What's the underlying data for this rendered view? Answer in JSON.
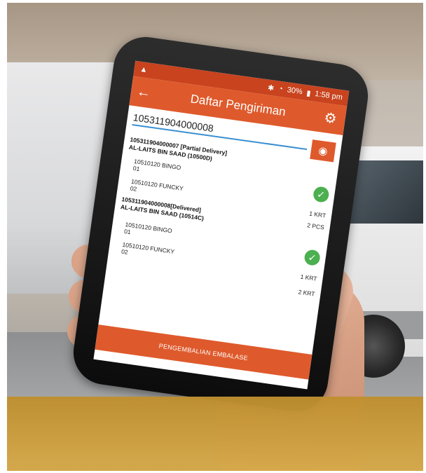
{
  "status_bar": {
    "warning_icon": "warning-icon",
    "battery": "30%",
    "time": "1:58 pm"
  },
  "app_bar": {
    "back_icon": "arrow-left-icon",
    "title": "Daftar Pengiriman",
    "settings_icon": "gear-icon"
  },
  "search": {
    "value": "105311904000008"
  },
  "deliveries": [
    {
      "header": "105311904000007 [Partial Delivery]",
      "customer": "AL-LAITS BIN SAAD (10500D)",
      "items": [
        {
          "code": "10510120",
          "name": "BINGO",
          "line": "01",
          "qty": "1 KRT"
        },
        {
          "code": "10510120",
          "name": "FUNCKY",
          "line": "02",
          "qty": "2 PCS"
        }
      ]
    },
    {
      "header": "105311904000008[Delivered]",
      "customer": "AL-LAITS BIN SAAD (10514C)",
      "items": [
        {
          "code": "10510120",
          "name": "BINGO",
          "line": "01",
          "qty": "1 KRT"
        },
        {
          "code": "10510120",
          "name": "FUNCKY",
          "line": "02",
          "qty": "2 KRT"
        }
      ]
    }
  ],
  "footer_button": "PENGEMBALIAN EMBALASE",
  "colors": {
    "primary": "#de5a2c",
    "status": "#c8431e",
    "success": "#4caf50",
    "accent_line": "#3a8fd0",
    "overlay": "#c4933a"
  }
}
